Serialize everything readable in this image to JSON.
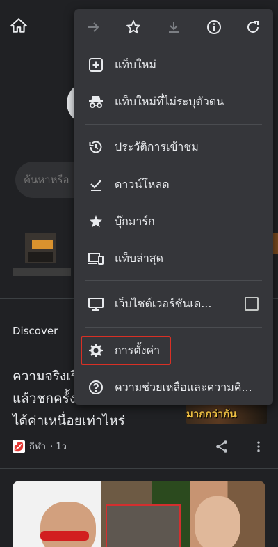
{
  "background": {
    "search_placeholder": "ค้นหาหรือ",
    "discover_label": "Discover",
    "article": {
      "title": "ความจริงเรื่\nแล้วชกครั้ง\nได้ค่าเหนื่อยเท่าไหร่",
      "thumb_text": "มากกว่ากัน",
      "source": "กีฬา",
      "age": "· 1ว"
    },
    "icons": {
      "home": "home-icon",
      "share": "share-icon",
      "more": "more-vert-icon"
    }
  },
  "menu": {
    "top_icons": [
      "forward-icon",
      "bookmark-star-icon",
      "download-icon",
      "info-icon",
      "refresh-icon"
    ],
    "items": [
      {
        "label": "แท็บใหม่",
        "icon": "new-tab-icon"
      },
      {
        "label": "แท็บใหม่ที่ไม่ระบุตัวตน",
        "icon": "incognito-icon"
      },
      {
        "label": "ประวัติการเข้าชม",
        "icon": "history-icon"
      },
      {
        "label": "ดาวน์โหลด",
        "icon": "downloads-icon"
      },
      {
        "label": "บุ๊กมาร์ก",
        "icon": "bookmarks-icon"
      },
      {
        "label": "แท็บล่าสุด",
        "icon": "recent-tabs-icon"
      },
      {
        "label": "เว็บไซต์เวอร์ชันเด...",
        "icon": "desktop-site-icon",
        "checked": false
      },
      {
        "label": "การตั้งค่า",
        "icon": "settings-gear-icon",
        "highlighted": true
      },
      {
        "label": "ความช่วยเหลือและความคิ...",
        "icon": "help-icon"
      }
    ],
    "colors": {
      "background": "#35363a",
      "text": "#e8eaed",
      "highlight_border": "#d93025"
    }
  }
}
